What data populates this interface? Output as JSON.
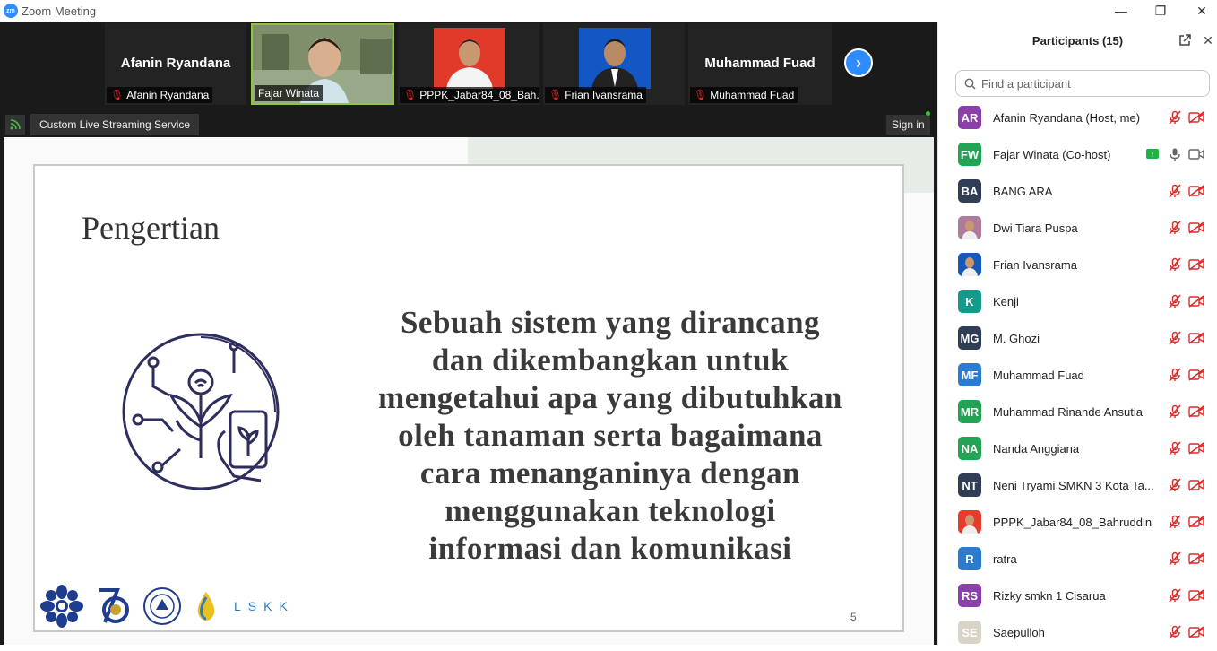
{
  "window": {
    "title": "Zoom Meeting",
    "logo": "zm"
  },
  "strip": {
    "tiles": [
      {
        "name": "Afanin Ryandana",
        "label": "Afanin Ryandana",
        "muted": true
      },
      {
        "name": "",
        "label": "Fajar Winata",
        "muted": false
      },
      {
        "name": "",
        "label": "PPPK_Jabar84_08_Bah...",
        "muted": true
      },
      {
        "name": "",
        "label": "Frian Ivansrama",
        "muted": true
      },
      {
        "name": "Muhammad Fuad",
        "label": "Muhammad Fuad",
        "muted": true
      }
    ]
  },
  "stream": {
    "service_label": "Custom Live Streaming Service",
    "signin_label": "Sign in"
  },
  "slide": {
    "heading": "Pengertian",
    "body_lines": [
      "Sebuah sistem yang dirancang",
      "dan dikembangkan untuk",
      "mengetahui apa yang dibutuhkan",
      "oleh tanaman serta bagaimana",
      "cara menanganinya dengan",
      "menggunakan teknologi",
      "informasi dan komunikasi"
    ],
    "page_number": "5",
    "logo_text": "LSKK"
  },
  "panel": {
    "title": "Participants (15)",
    "search_placeholder": "Find a participant",
    "participants": [
      {
        "initials": "AR",
        "name": "Afanin Ryandana (Host, me)",
        "color": "#8b3fa8",
        "muted": true,
        "video_off": true,
        "sharing": false
      },
      {
        "initials": "FW",
        "name": "Fajar Winata (Co-host)",
        "color": "#23a455",
        "muted": false,
        "video_off": false,
        "sharing": true
      },
      {
        "initials": "BA",
        "name": "BANG ARA",
        "color": "#2f3e55",
        "muted": true,
        "video_off": true,
        "sharing": false
      },
      {
        "initials": "",
        "name": "Dwi Tiara Puspa",
        "color": "#b07a9c",
        "muted": true,
        "video_off": true,
        "sharing": false,
        "photo": true
      },
      {
        "initials": "",
        "name": "Frian Ivansrama",
        "color": "#1858b8",
        "muted": true,
        "video_off": true,
        "sharing": false,
        "photo": true
      },
      {
        "initials": "K",
        "name": "Kenji",
        "color": "#129a8a",
        "muted": true,
        "video_off": true,
        "sharing": false
      },
      {
        "initials": "MG",
        "name": "M. Ghozi",
        "color": "#2f3e55",
        "muted": true,
        "video_off": true,
        "sharing": false
      },
      {
        "initials": "MF",
        "name": "Muhammad Fuad",
        "color": "#2b7bd0",
        "muted": true,
        "video_off": true,
        "sharing": false
      },
      {
        "initials": "MR",
        "name": "Muhammad Rinande Ansutia",
        "color": "#23a455",
        "muted": true,
        "video_off": true,
        "sharing": false
      },
      {
        "initials": "NA",
        "name": "Nanda  Anggiana",
        "color": "#23a455",
        "muted": true,
        "video_off": true,
        "sharing": false
      },
      {
        "initials": "NT",
        "name": "Neni Tryami SMKN  3 Kota  Ta...",
        "color": "#2f3e55",
        "muted": true,
        "video_off": true,
        "sharing": false
      },
      {
        "initials": "",
        "name": "PPPK_Jabar84_08_Bahruddin",
        "color": "#e63c2d",
        "muted": true,
        "video_off": true,
        "sharing": false,
        "photo": true
      },
      {
        "initials": "R",
        "name": "ratra",
        "color": "#2b7bd0",
        "muted": true,
        "video_off": true,
        "sharing": false
      },
      {
        "initials": "RS",
        "name": "Rizky smkn 1 Cisarua",
        "color": "#8b3fa8",
        "muted": true,
        "video_off": true,
        "sharing": false
      },
      {
        "initials": "SE",
        "name": "Saepulloh",
        "color": "#d9d4c8",
        "muted": true,
        "video_off": true,
        "sharing": false,
        "photo": true
      }
    ]
  }
}
